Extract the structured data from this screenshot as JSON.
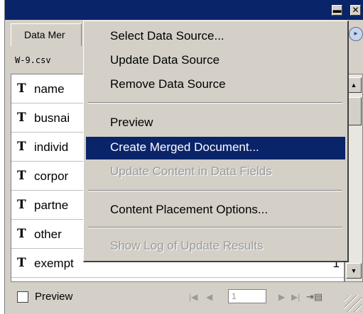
{
  "panel": {
    "minimize_glyph": "▬",
    "close_glyph": "✕",
    "tab_label": "Data Mer",
    "menu_button_glyph": "▸",
    "data_source": "W-9.csv"
  },
  "fields": [
    {
      "type_glyph": "T",
      "name": "name",
      "value": ""
    },
    {
      "type_glyph": "T",
      "name": "busnai",
      "value": ""
    },
    {
      "type_glyph": "T",
      "name": "individ",
      "value": ""
    },
    {
      "type_glyph": "T",
      "name": "corpor",
      "value": ""
    },
    {
      "type_glyph": "T",
      "name": "partne",
      "value": ""
    },
    {
      "type_glyph": "T",
      "name": "other",
      "value": ""
    },
    {
      "type_glyph": "T",
      "name": "exempt",
      "value": "1"
    }
  ],
  "scrollbar": {
    "up_glyph": "▲",
    "down_glyph": "▼"
  },
  "bottombar": {
    "preview_label": "Preview",
    "first_glyph": "|◀",
    "prev_glyph": "◀",
    "page_value": "1",
    "next_glyph": "▶",
    "last_glyph": "▶|",
    "goto_glyph": "⇥▤"
  },
  "menu": {
    "items": [
      {
        "label": "Select Data Source...",
        "state": "normal"
      },
      {
        "label": "Update Data Source",
        "state": "normal"
      },
      {
        "label": "Remove Data Source",
        "state": "normal"
      },
      {
        "label": "Preview",
        "state": "normal"
      },
      {
        "label": "Create Merged Document...",
        "state": "highlighted"
      },
      {
        "label": "Update Content in Data Fields",
        "state": "disabled"
      },
      {
        "label": "Content Placement Options...",
        "state": "normal"
      },
      {
        "label": "Show Log of Update Results",
        "state": "disabled"
      }
    ]
  },
  "colors": {
    "titlebar": "#0a246a",
    "highlight": "#0a246a",
    "panel_face": "#d4d0c8",
    "disabled_text": "#9a9a9a"
  }
}
